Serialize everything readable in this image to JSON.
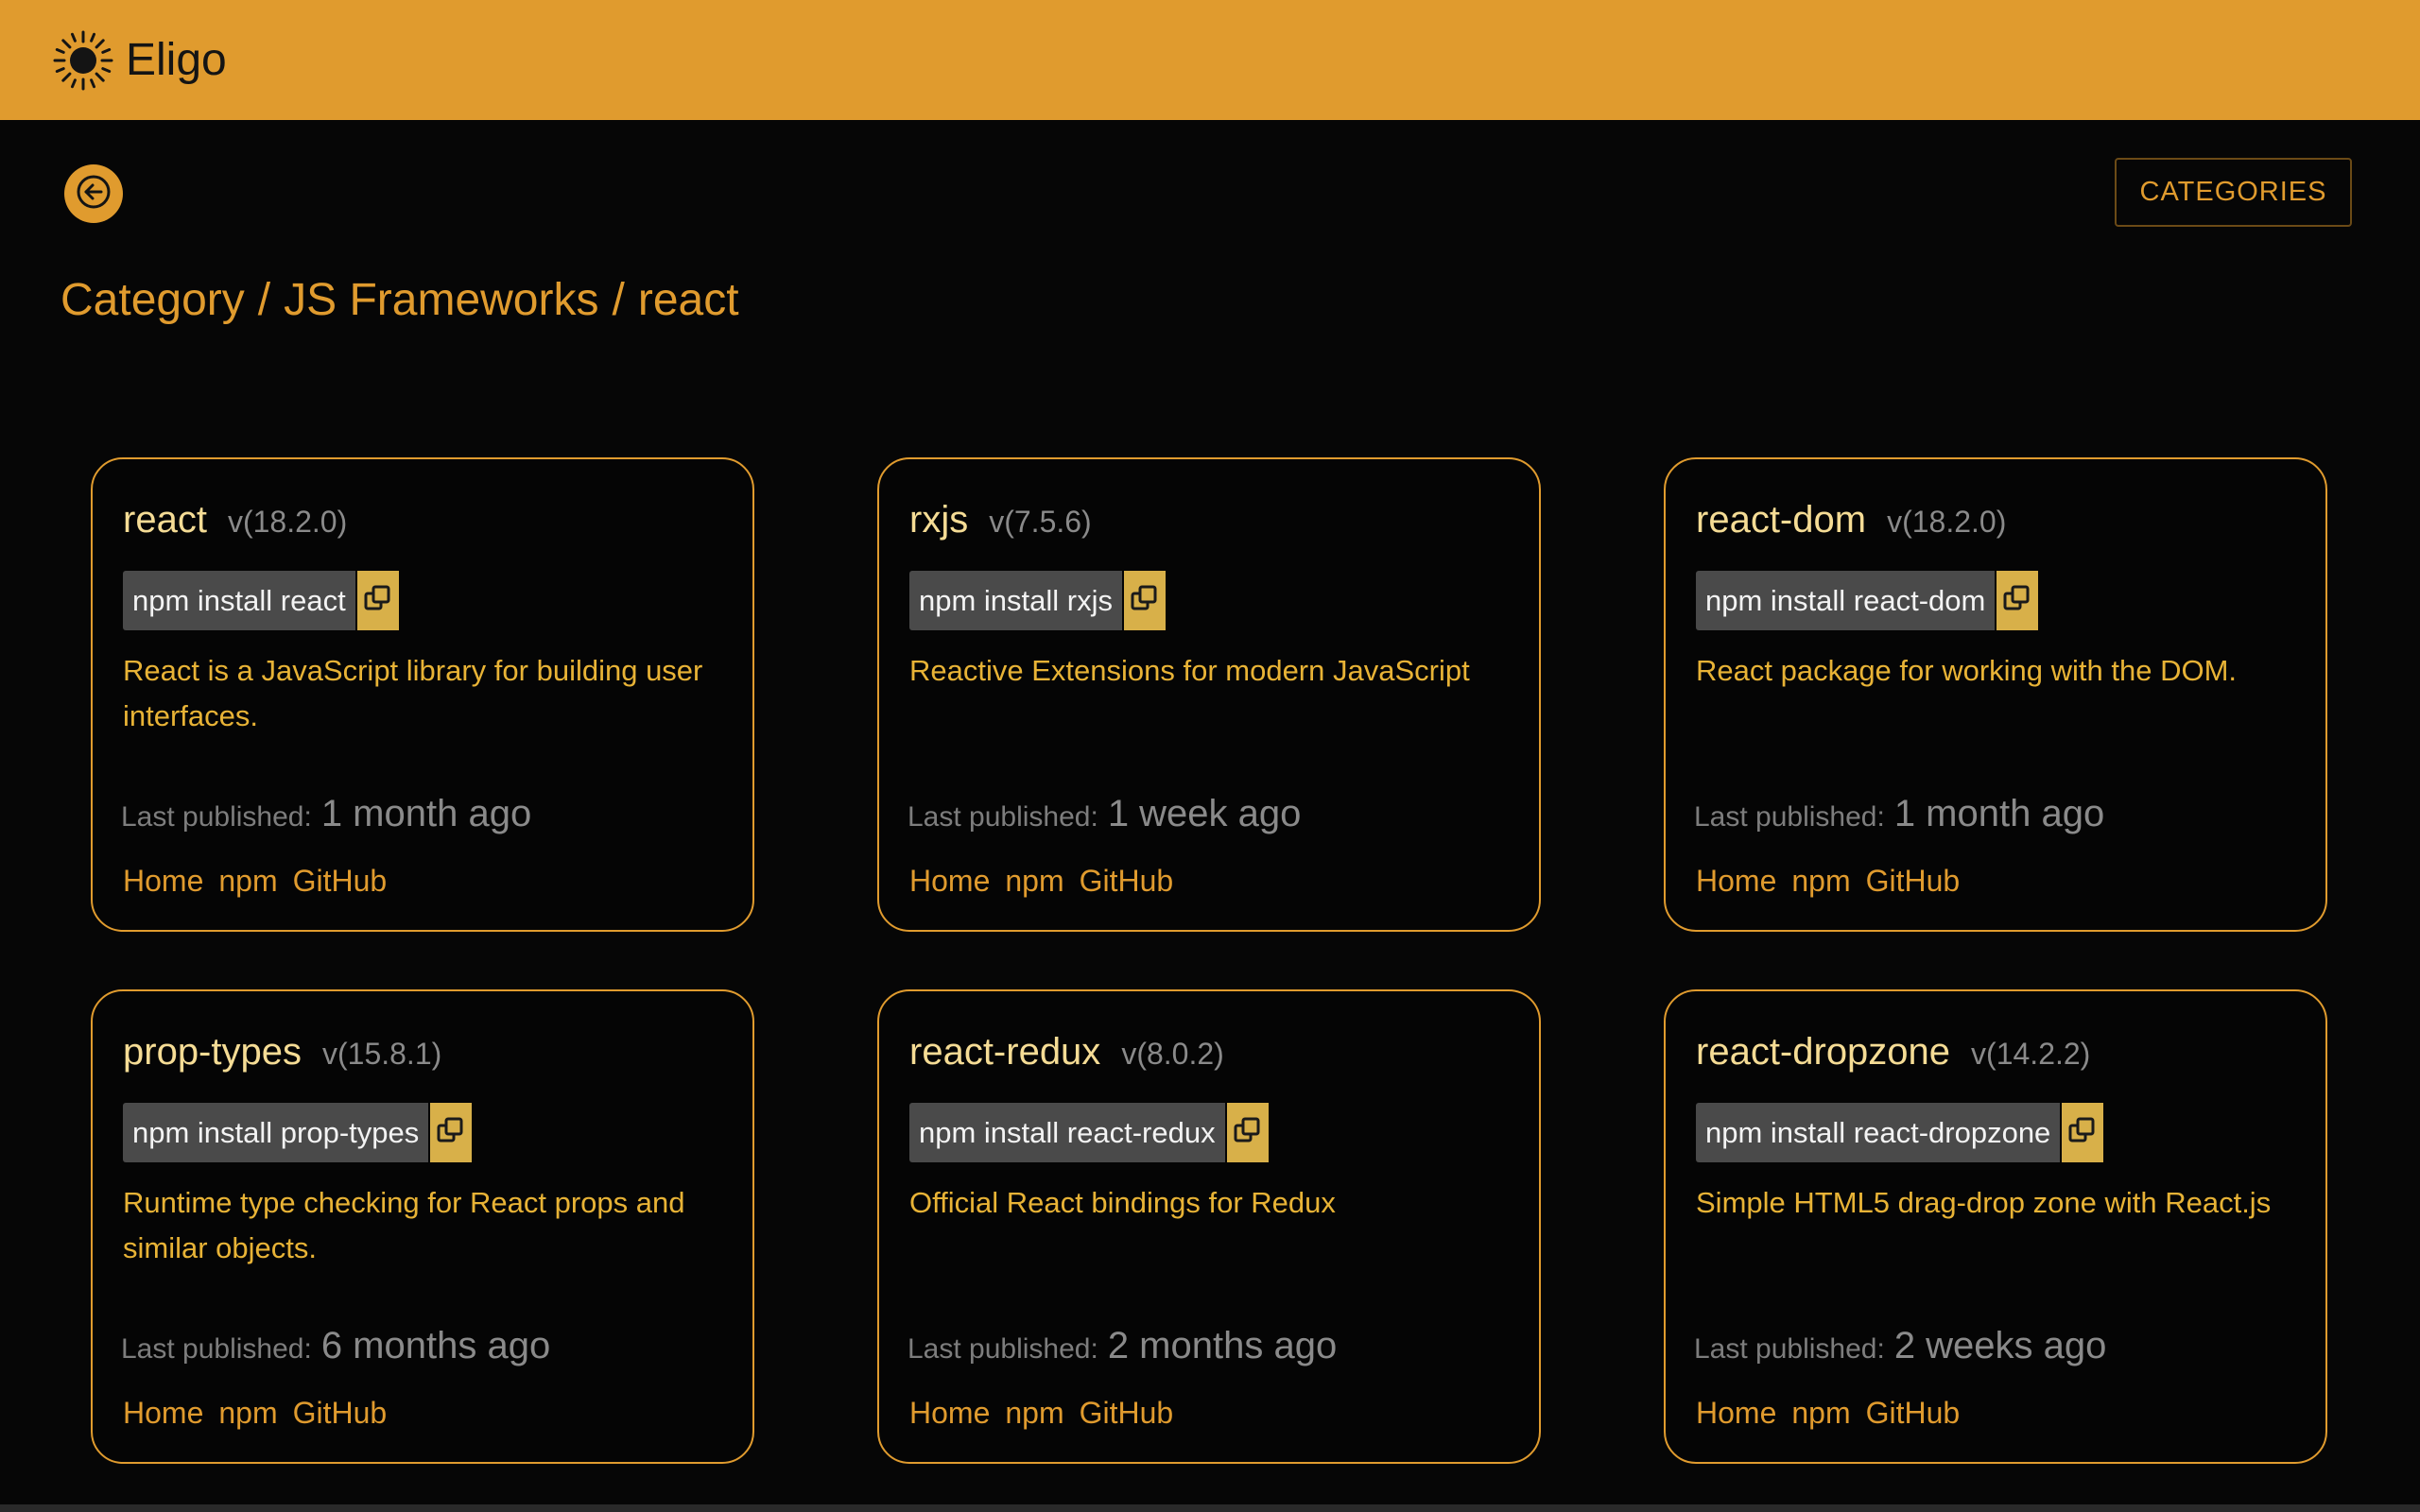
{
  "app": {
    "name": "Eligo",
    "logo_icon": "sun-icon"
  },
  "colors": {
    "accent": "#e09b2e",
    "background": "#060606",
    "copy_button": "#d8b049"
  },
  "nav": {
    "back_icon": "arrow-left-icon",
    "categories_label": "CATEGORIES"
  },
  "breadcrumb": {
    "root": "Category",
    "section": "JS Frameworks",
    "current": "react",
    "separator": "/"
  },
  "cards": [
    {
      "name": "react",
      "version": "v(18.2.0)",
      "install": "npm install react",
      "description": "React is a JavaScript library for building user interfaces.",
      "published_label": "Last published:",
      "published": "1 month ago",
      "links": {
        "home": "Home",
        "npm": "npm",
        "github": "GitHub"
      }
    },
    {
      "name": "rxjs",
      "version": "v(7.5.6)",
      "install": "npm install rxjs",
      "description": "Reactive Extensions for modern JavaScript",
      "published_label": "Last published:",
      "published": "1 week ago",
      "links": {
        "home": "Home",
        "npm": "npm",
        "github": "GitHub"
      }
    },
    {
      "name": "react-dom",
      "version": "v(18.2.0)",
      "install": "npm install react-dom",
      "description": "React package for working with the DOM.",
      "published_label": "Last published:",
      "published": "1 month ago",
      "links": {
        "home": "Home",
        "npm": "npm",
        "github": "GitHub"
      }
    },
    {
      "name": "prop-types",
      "version": "v(15.8.1)",
      "install": "npm install prop-types",
      "description": "Runtime type checking for React props and similar objects.",
      "published_label": "Last published:",
      "published": "6 months ago",
      "links": {
        "home": "Home",
        "npm": "npm",
        "github": "GitHub"
      }
    },
    {
      "name": "react-redux",
      "version": "v(8.0.2)",
      "install": "npm install react-redux",
      "description": "Official React bindings for Redux",
      "published_label": "Last published:",
      "published": "2 months ago",
      "links": {
        "home": "Home",
        "npm": "npm",
        "github": "GitHub"
      }
    },
    {
      "name": "react-dropzone",
      "version": "v(14.2.2)",
      "install": "npm install react-dropzone",
      "description": "Simple HTML5 drag-drop zone with React.js",
      "published_label": "Last published:",
      "published": "2 weeks ago",
      "links": {
        "home": "Home",
        "npm": "npm",
        "github": "GitHub"
      }
    }
  ]
}
